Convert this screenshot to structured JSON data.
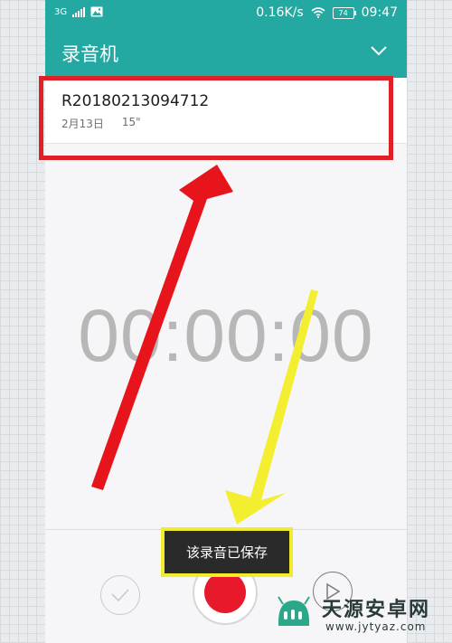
{
  "status_bar": {
    "network": "3G",
    "speed": "0.16K/s",
    "battery": "74",
    "time": "09:47"
  },
  "header": {
    "title": "录音机",
    "dropdown_icon": "chevron-down-icon"
  },
  "recordings": [
    {
      "name": "R20180213094712",
      "date": "2月13日",
      "duration": "15\""
    }
  ],
  "timer": "00:00:00",
  "toast": "该录音已保存",
  "controls": {
    "left_icon": "check-icon",
    "center_icon": "record-icon",
    "right_icon": "play-icon"
  },
  "watermark": {
    "title": "天源安卓网",
    "url": "www.jytyaz.com"
  },
  "colors": {
    "header": "#23a9a2",
    "record": "#e8192b",
    "highlight_red": "#e02027",
    "highlight_yellow": "#f2ec2c"
  }
}
